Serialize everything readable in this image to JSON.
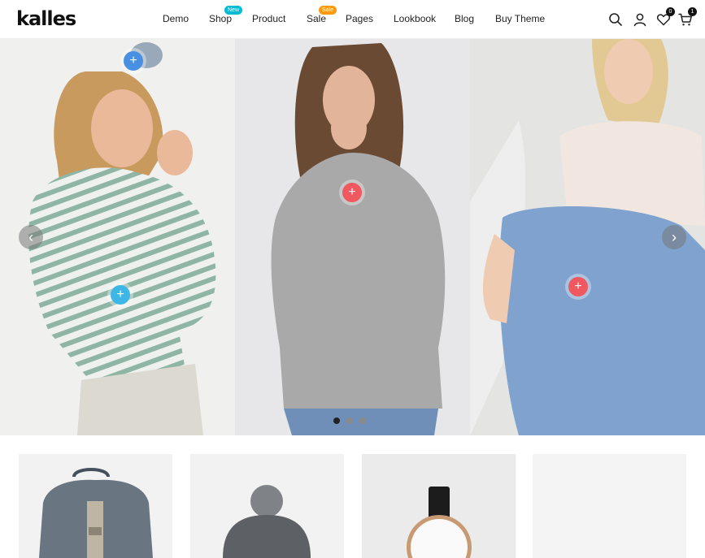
{
  "header": {
    "logo": "kalles",
    "nav": [
      {
        "label": "Demo"
      },
      {
        "label": "Shop",
        "badge": "New",
        "badge_color": "#01bad4"
      },
      {
        "label": "Product"
      },
      {
        "label": "Sale",
        "badge": "Sale",
        "badge_color": "#ff9a0f"
      },
      {
        "label": "Pages"
      },
      {
        "label": "Lookbook"
      },
      {
        "label": "Blog"
      },
      {
        "label": "Buy Theme"
      }
    ],
    "icons": {
      "search": "search-icon",
      "account": "user-icon",
      "wishlist": "heart-icon",
      "cart": "cart-icon"
    },
    "wishlist_count": "0",
    "cart_count": "1"
  },
  "hero": {
    "hotspot_symbol": "+",
    "hotspot_colors": [
      "#4a90e2",
      "#3fb7e6",
      "#f0585f",
      "#f0585f"
    ],
    "prev_symbol": "‹",
    "next_symbol": "›",
    "slides": 3,
    "active_slide": 1
  },
  "products": [
    {
      "name": "bag-product"
    },
    {
      "name": "beanie-product"
    },
    {
      "name": "watch-product"
    },
    {
      "name": "empty-product"
    }
  ]
}
